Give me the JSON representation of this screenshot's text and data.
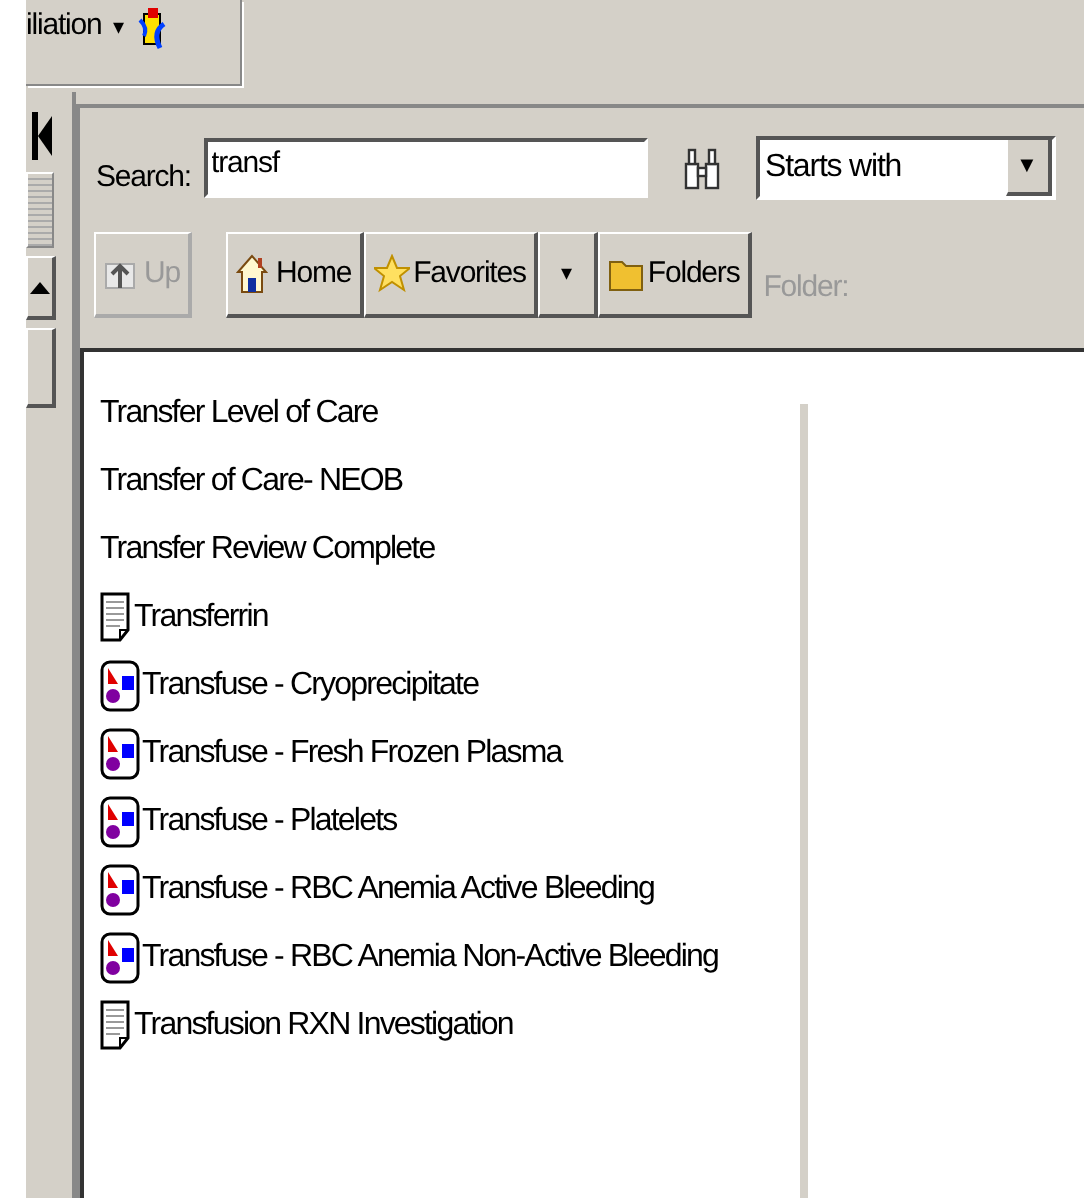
{
  "top_tab": {
    "label": "iliation",
    "caret": "▾"
  },
  "search": {
    "label": "Search:",
    "value": "transf",
    "mode": "Starts with",
    "mode_caret": "▼"
  },
  "toolbar": [
    {
      "kind": "up",
      "label": "Up",
      "disabled": true
    },
    {
      "kind": "home",
      "label": "Home",
      "disabled": false
    },
    {
      "kind": "favorites",
      "label": "Favorites",
      "disabled": false
    },
    {
      "kind": "menu",
      "label": "▾",
      "disabled": false
    },
    {
      "kind": "folders",
      "label": "Folders",
      "disabled": false
    }
  ],
  "folder_label": "Folder:",
  "results": [
    {
      "kind": "plain",
      "label": "Transfer Level of Care"
    },
    {
      "kind": "plain",
      "label": "Transfer of Care- NEOB"
    },
    {
      "kind": "plain",
      "label": "Transfer Review Complete"
    },
    {
      "kind": "document",
      "label": "Transferrin"
    },
    {
      "kind": "orderset",
      "label": "Transfuse - Cryoprecipitate"
    },
    {
      "kind": "orderset",
      "label": "Transfuse - Fresh Frozen Plasma"
    },
    {
      "kind": "orderset",
      "label": "Transfuse - Platelets"
    },
    {
      "kind": "orderset",
      "label": "Transfuse - RBC Anemia Active Bleeding"
    },
    {
      "kind": "orderset",
      "label": "Transfuse - RBC Anemia Non-Active Bleeding"
    },
    {
      "kind": "document",
      "label": "Transfusion RXN Investigation"
    }
  ]
}
